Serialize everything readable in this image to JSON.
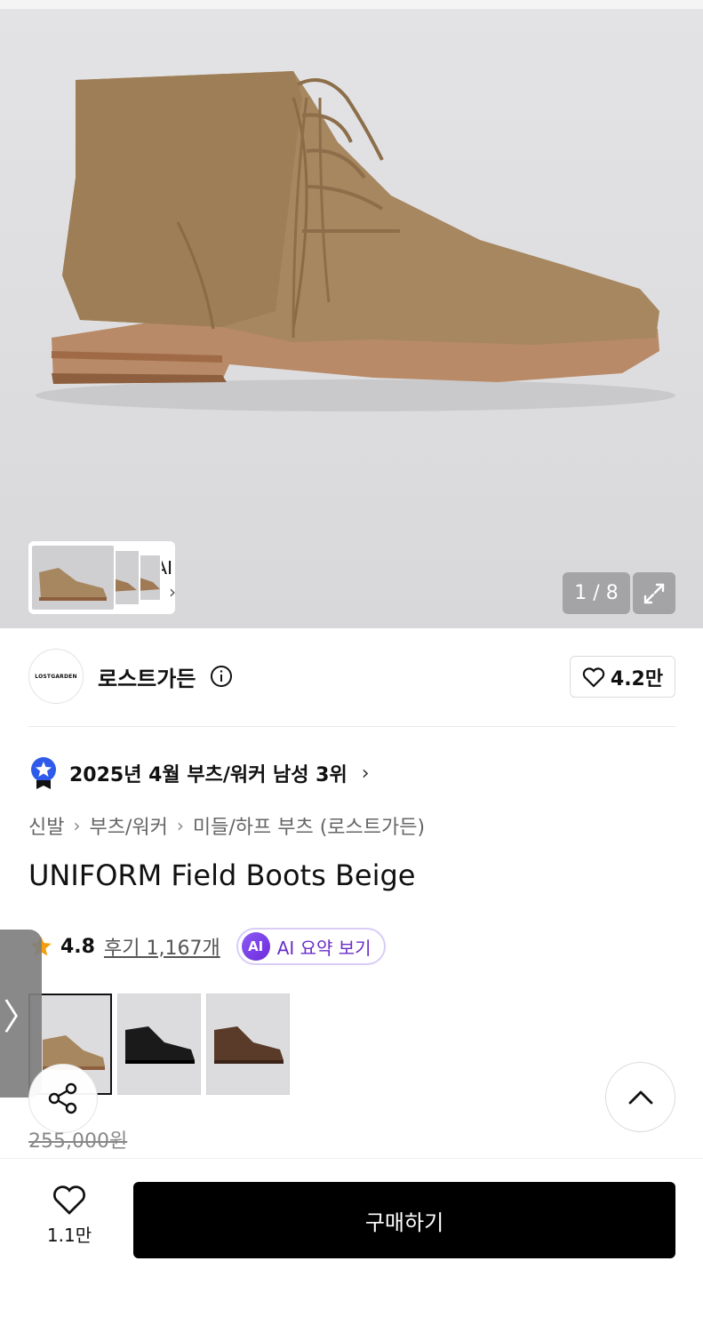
{
  "gallery": {
    "counter": "1 / 8",
    "ai_thumb_label": "AI",
    "ai_thumb_arrow": "›"
  },
  "brand": {
    "logo_text": "LOSTGARDEN",
    "name": "로스트가든",
    "like_count": "4.2만"
  },
  "ranking": {
    "text": "2025년 4월 부츠/워커 남성 3위",
    "arrow": "›"
  },
  "breadcrumb": {
    "items": [
      "신발",
      "부츠/워커",
      "미들/하프 부츠 (로스트가든)"
    ],
    "separator": "›"
  },
  "product": {
    "title": "UNIFORM Field Boots Beige",
    "rating": "4.8",
    "reviews": "후기 1,167개",
    "ai_badge": "AI",
    "ai_summary_label": "AI 요약 보기",
    "original_price": "255,000원"
  },
  "swatches": [
    {
      "color": "beige",
      "selected": true
    },
    {
      "color": "black",
      "selected": false
    },
    {
      "color": "brown",
      "selected": false
    }
  ],
  "side_tab_arrow": "〉",
  "bottom_bar": {
    "wish_count": "1.1만",
    "buy_label": "구매하기"
  },
  "colors": {
    "accent_purple": "#6a2ec7",
    "star": "#f59e0b",
    "buy_bg": "#000000",
    "rank_badge": "#2f5bea"
  }
}
